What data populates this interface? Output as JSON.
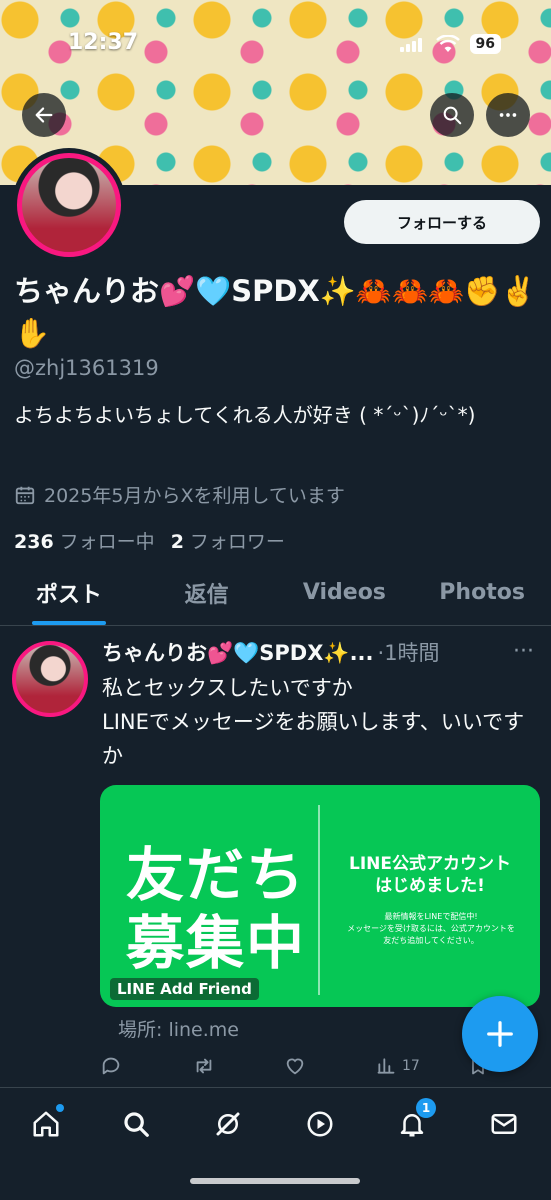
{
  "status": {
    "time": "12:37",
    "battery": "96"
  },
  "profile": {
    "display_name": "ちゃんりお💕🩵SPDX✨🦀🦀🦀✊✌️✋",
    "handle": "@zhj1361319",
    "bio": "よちよちよいちょしてくれる人が好き ( *´ᵕ`)ﾉ´ᵕ`*)",
    "joined": "2025年5月からXを利用しています",
    "following_count": "236",
    "following_label": "フォロー中",
    "followers_count": "2",
    "followers_label": "フォロワー",
    "follow_button": "フォローする"
  },
  "tabs": [
    "ポスト",
    "返信",
    "Videos",
    "Photos"
  ],
  "post": {
    "name": "ちゃんりお💕🩵SPDX✨...",
    "time": "·1時間",
    "text": "私とセックスしたいですか\nLINEでメッセージをお願いします、いいですか",
    "card": {
      "big_text": "友だち\n募集中",
      "title": "LINE公式アカウント\nはじめました!",
      "small": "最新情報をLINEで配信中!\nメッセージを受け取るには、公式アカウントを\n友だち追加してください。",
      "badge": "LINE Add Friend"
    },
    "source": "場所: line.me",
    "views": "17"
  },
  "nav": {
    "notifications_badge": "1"
  },
  "colors": {
    "accent": "#1d9bf0",
    "background": "#15202b",
    "line_green": "#06c755",
    "pink": "#f91880"
  }
}
